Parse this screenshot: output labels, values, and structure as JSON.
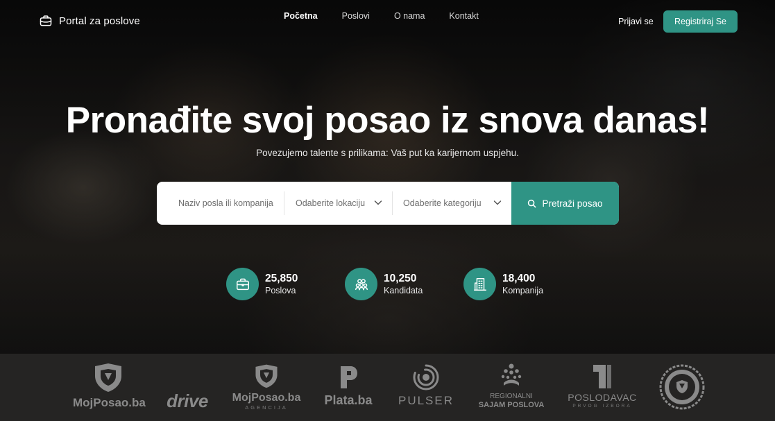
{
  "nav": {
    "brand": "Portal za poslove",
    "links": [
      "Početna",
      "Poslovi",
      "O nama",
      "Kontakt"
    ],
    "login": "Prijavi se",
    "register": "Registriraj Se"
  },
  "hero": {
    "title": "Pronađite svoj posao iz snova danas!",
    "subtitle": "Povezujemo talente s prilikama: Vaš put ka karijernom uspjehu."
  },
  "search": {
    "keyword_placeholder": "Naziv posla ili kompanija",
    "location": "Odaberite lokaciju",
    "category": "Odaberite kategoriju",
    "button": "Pretraži posao"
  },
  "stats": [
    {
      "value": "25,850",
      "label": "Poslova",
      "icon": "briefcase-icon"
    },
    {
      "value": "10,250",
      "label": "Kandidata",
      "icon": "users-icon"
    },
    {
      "value": "18,400",
      "label": "Kompanija",
      "icon": "building-icon"
    }
  ],
  "partners": [
    {
      "name": "MojPosao.ba",
      "sub": ""
    },
    {
      "name": "drive",
      "sub": ""
    },
    {
      "name": "MojPosao.ba",
      "sub": "AGENCIJA"
    },
    {
      "name": "Plata.ba",
      "sub": ""
    },
    {
      "name": "PULSER",
      "sub": ""
    },
    {
      "name": "REGIONALNI",
      "sub": "SAJAM POSLOVA"
    },
    {
      "name": "POSLODAVAC",
      "sub": "PRVOG IZBORA"
    }
  ],
  "colors": {
    "accent": "#2f9485",
    "strip": "#252423"
  }
}
